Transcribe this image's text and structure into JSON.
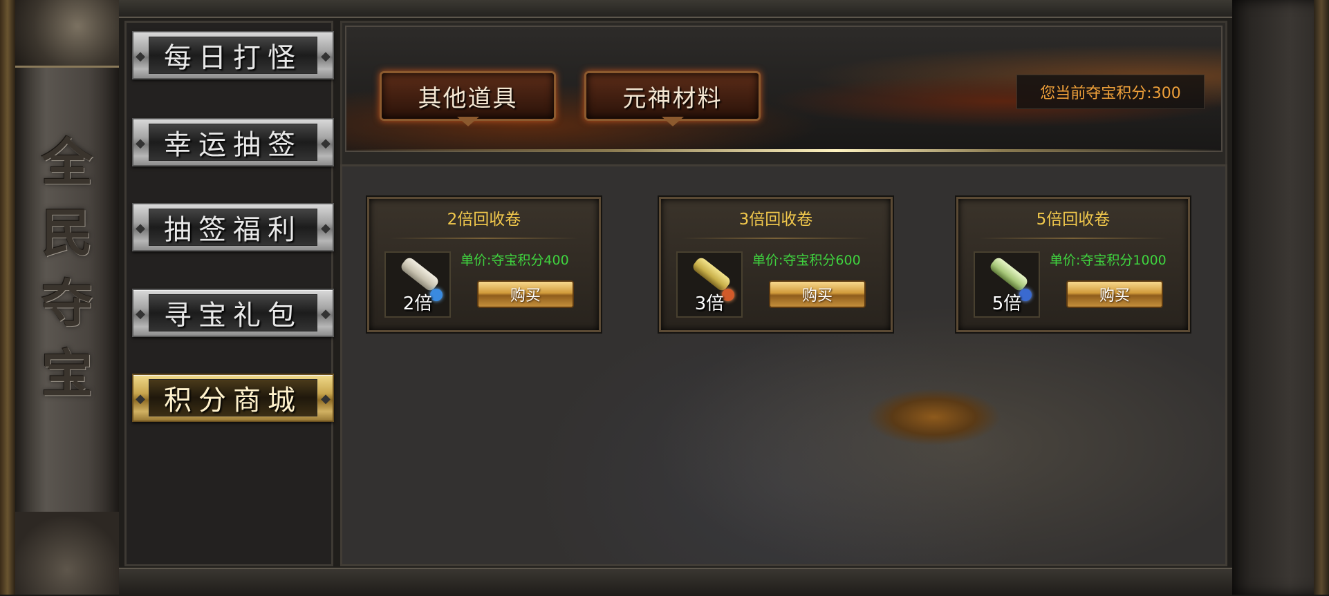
{
  "sidebar_title": [
    "全",
    "民",
    "夺",
    "宝"
  ],
  "nav": {
    "items": [
      {
        "label": "每日打怪",
        "active": false
      },
      {
        "label": "幸运抽签",
        "active": false
      },
      {
        "label": "抽签福利",
        "active": false
      },
      {
        "label": "寻宝礼包",
        "active": false
      },
      {
        "label": "积分商城",
        "active": true
      }
    ]
  },
  "tabs": [
    {
      "label": "其他道具"
    },
    {
      "label": "元神材料"
    }
  ],
  "points": {
    "text": "您当前夺宝积分:300"
  },
  "shop": {
    "items": [
      {
        "title": "2倍回收卷",
        "icon": "scroll-icon",
        "icon_label": "2倍",
        "price": "单价:夺宝积分400",
        "buy": "购买"
      },
      {
        "title": "3倍回收卷",
        "icon": "scroll-icon",
        "icon_label": "3倍",
        "price": "单价:夺宝积分600",
        "buy": "购买"
      },
      {
        "title": "5倍回收卷",
        "icon": "scroll-icon",
        "icon_label": "5倍",
        "price": "单价:夺宝积分1000",
        "buy": "购买"
      }
    ]
  },
  "colors": {
    "price": "#3fd43f",
    "title": "#f2c94c",
    "points": "#f0a13a",
    "active_nav": "#c9a64f"
  }
}
